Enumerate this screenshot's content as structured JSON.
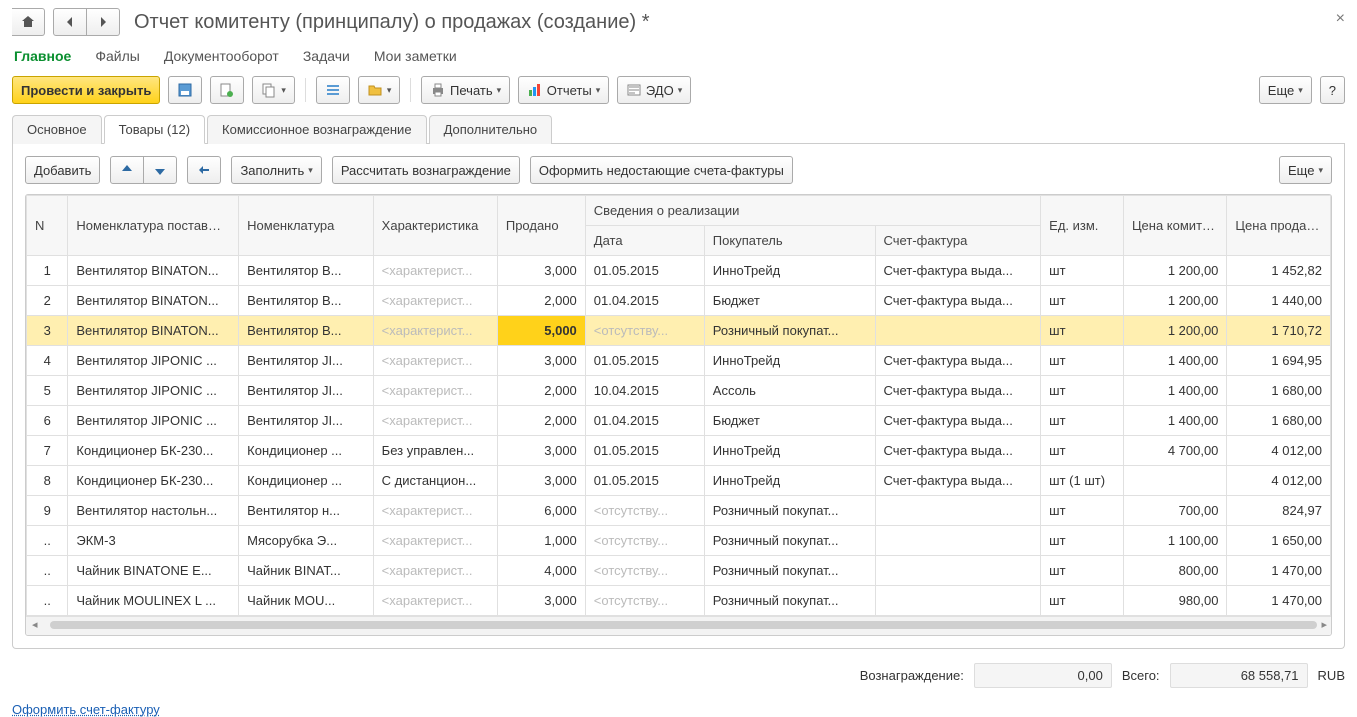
{
  "title": "Отчет комитенту (принципалу) о продажах (создание) *",
  "menu": [
    "Главное",
    "Файлы",
    "Документооборот",
    "Задачи",
    "Мои заметки"
  ],
  "activeMenu": 0,
  "toolbar": {
    "runClose": "Провести и закрыть",
    "print": "Печать",
    "reports": "Отчеты",
    "edo": "ЭДО",
    "more": "Еще",
    "help": "?"
  },
  "tabs": [
    "Основное",
    "Товары (12)",
    "Комиссионное вознаграждение",
    "Дополнительно"
  ],
  "activeTab": 1,
  "panelToolbar": {
    "add": "Добавить",
    "fill": "Заполнить",
    "calc": "Рассчитать вознаграждение",
    "invoices": "Оформить недостающие счета-фактуры",
    "more": "Еще"
  },
  "cols": {
    "n": "N",
    "supplierNom": "Номенклатура поставщика",
    "nom": "Номенклатура",
    "char": "Характеристика",
    "sold": "Продано",
    "salesInfo": "Сведения о реализации",
    "date": "Дата",
    "buyer": "Покупатель",
    "invoice": "Счет-фактура",
    "unit": "Ед. изм.",
    "priceCom": "Цена комитента",
    "priceSale": "Цена продажи"
  },
  "placeholders": {
    "char": "<характерист...",
    "absent": "<отсутству..."
  },
  "rows": [
    {
      "n": "1",
      "sup": "Вентилятор BINATON...",
      "nom": "Вентилятор B...",
      "char": "",
      "sold": "3,000",
      "date": "01.05.2015",
      "buyer": "ИнноТрейд",
      "inv": "Счет-фактура выда...",
      "unit": "шт",
      "pc": "1 200,00",
      "ps": "1 452,82"
    },
    {
      "n": "2",
      "sup": "Вентилятор BINATON...",
      "nom": "Вентилятор B...",
      "char": "",
      "sold": "2,000",
      "date": "01.04.2015",
      "buyer": "Бюджет",
      "inv": "Счет-фактура выда...",
      "unit": "шт",
      "pc": "1 200,00",
      "ps": "1 440,00"
    },
    {
      "n": "3",
      "sup": "Вентилятор BINATON...",
      "nom": "Вентилятор B...",
      "char": "",
      "sold": "5,000",
      "date": "",
      "buyer": "Розничный покупат...",
      "inv": "",
      "unit": "шт",
      "pc": "1 200,00",
      "ps": "1 710,72",
      "sel": true
    },
    {
      "n": "4",
      "sup": "Вентилятор JIPONIC ...",
      "nom": "Вентилятор JI...",
      "char": "",
      "sold": "3,000",
      "date": "01.05.2015",
      "buyer": "ИнноТрейд",
      "inv": "Счет-фактура выда...",
      "unit": "шт",
      "pc": "1 400,00",
      "ps": "1 694,95"
    },
    {
      "n": "5",
      "sup": "Вентилятор JIPONIC ...",
      "nom": "Вентилятор JI...",
      "char": "",
      "sold": "2,000",
      "date": "10.04.2015",
      "buyer": "Ассоль",
      "inv": "Счет-фактура выда...",
      "unit": "шт",
      "pc": "1 400,00",
      "ps": "1 680,00"
    },
    {
      "n": "6",
      "sup": "Вентилятор JIPONIC ...",
      "nom": "Вентилятор JI...",
      "char": "",
      "sold": "2,000",
      "date": "01.04.2015",
      "buyer": "Бюджет",
      "inv": "Счет-фактура выда...",
      "unit": "шт",
      "pc": "1 400,00",
      "ps": "1 680,00"
    },
    {
      "n": "7",
      "sup": "Кондиционер БК-230...",
      "nom": "Кондиционер ...",
      "char": "Без управлен...",
      "sold": "3,000",
      "date": "01.05.2015",
      "buyer": "ИнноТрейд",
      "inv": "Счет-фактура выда...",
      "unit": "шт",
      "pc": "4 700,00",
      "ps": "4 012,00"
    },
    {
      "n": "8",
      "sup": "Кондиционер БК-230...",
      "nom": "Кондиционер ...",
      "char": "С дистанцион...",
      "sold": "3,000",
      "date": "01.05.2015",
      "buyer": "ИнноТрейд",
      "inv": "Счет-фактура выда...",
      "unit": "шт (1 шт)",
      "pc": "",
      "ps": "4 012,00"
    },
    {
      "n": "9",
      "sup": "Вентилятор настольн...",
      "nom": "Вентилятор н...",
      "char": "",
      "sold": "6,000",
      "date": "",
      "buyer": "Розничный покупат...",
      "inv": "",
      "unit": "шт",
      "pc": "700,00",
      "ps": "824,97"
    },
    {
      "n": "..",
      "sup": "ЭКМ-3",
      "nom": "Мясорубка Э...",
      "char": "",
      "sold": "1,000",
      "date": "",
      "buyer": "Розничный покупат...",
      "inv": "",
      "unit": "шт",
      "pc": "1 100,00",
      "ps": "1 650,00"
    },
    {
      "n": "..",
      "sup": "Чайник BINATONE  E...",
      "nom": "Чайник BINAT...",
      "char": "",
      "sold": "4,000",
      "date": "",
      "buyer": "Розничный покупат...",
      "inv": "",
      "unit": "шт",
      "pc": "800,00",
      "ps": "1 470,00"
    },
    {
      "n": "..",
      "sup": "Чайник MOULINEX L ...",
      "nom": "Чайник MOU...",
      "char": "",
      "sold": "3,000",
      "date": "",
      "buyer": "Розничный покупат...",
      "inv": "",
      "unit": "шт",
      "pc": "980,00",
      "ps": "1 470,00"
    }
  ],
  "totals": {
    "rewardLabel": "Вознаграждение:",
    "reward": "0,00",
    "totalLabel": "Всего:",
    "total": "68 558,71",
    "currency": "RUB"
  },
  "link": "Оформить счет-фактуру"
}
